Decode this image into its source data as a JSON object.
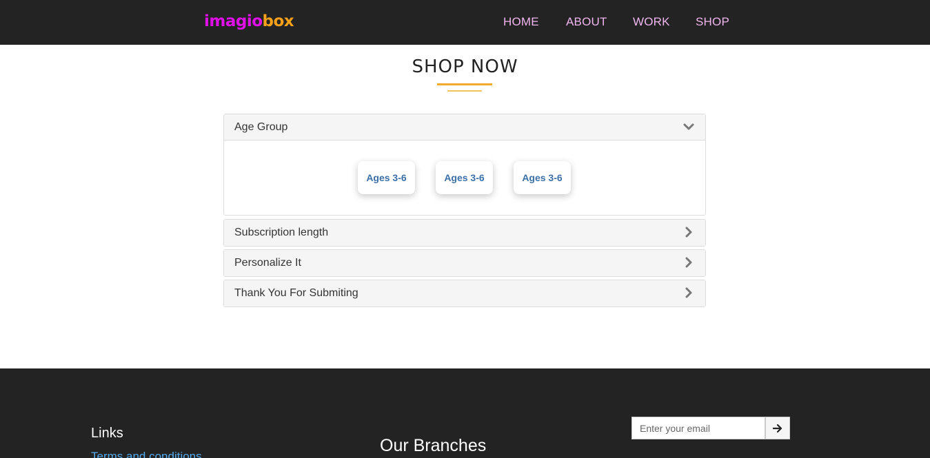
{
  "navbar": {
    "logo_part1": "imagio",
    "logo_part2": "box",
    "links": [
      "HOME",
      "ABOUT",
      "WORK",
      "SHOP"
    ]
  },
  "shop": {
    "title": "SHOP NOW",
    "accordion": [
      {
        "title": "Age Group",
        "state": "expanded",
        "icon": "chevron-down-icon",
        "options": [
          "Ages 3-6",
          "Ages 3-6",
          "Ages 3-6"
        ]
      },
      {
        "title": "Subscription length",
        "state": "collapsed",
        "icon": "chevron-right-icon"
      },
      {
        "title": "Personalize It",
        "state": "collapsed",
        "icon": "chevron-right-icon"
      },
      {
        "title": "Thank You For Submiting",
        "state": "collapsed",
        "icon": "chevron-right-icon"
      }
    ]
  },
  "footer": {
    "links_title": "Links",
    "first_link": "Terms and conditions",
    "branches_title": "Our Branches",
    "email_placeholder": "Enter your email",
    "submit_icon": "arrow-right-icon"
  },
  "colors": {
    "navbar_bg": "#232323",
    "logo_pink": "#e010e8",
    "logo_orange": "#f7a01a",
    "nav_link": "#f1b6f0",
    "accent_line": "#f2a92b",
    "option_text": "#3b6fa8",
    "footer_link": "#55aaee"
  }
}
